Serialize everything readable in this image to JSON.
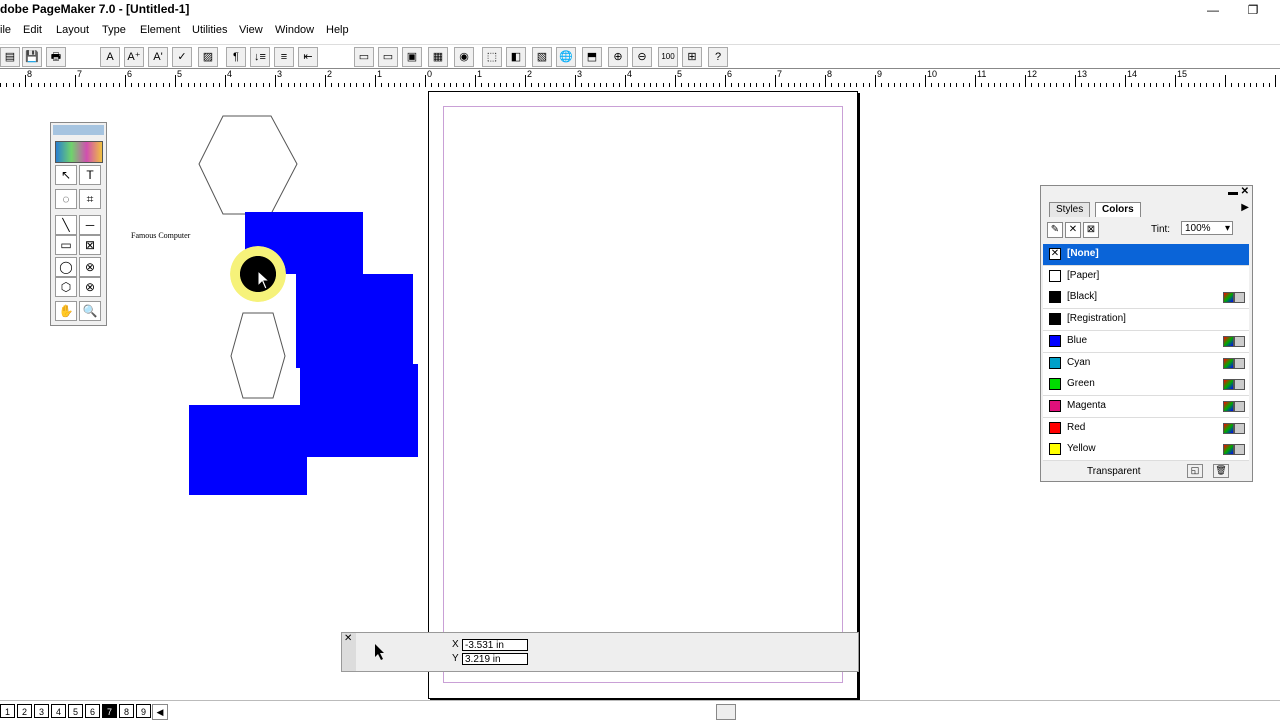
{
  "window": {
    "title": "dobe PageMaker 7.0 - [Untitled-1]",
    "minimize": "—",
    "restore": "❐"
  },
  "menu": [
    "ile",
    "Edit",
    "Layout",
    "Type",
    "Element",
    "Utilities",
    "View",
    "Window",
    "Help"
  ],
  "toolbar": [
    "▤",
    "💾",
    "🖶",
    "A",
    "A⁺",
    "A'",
    "✓",
    "▨",
    "¶",
    "↓≡",
    "≡",
    "⇤",
    "▭",
    "▭",
    "▣",
    "▦",
    "◉",
    "⬚",
    "◧",
    "▧",
    "🌐",
    "⬒",
    "⊕",
    "⊖",
    "100",
    "⊞",
    "?"
  ],
  "ruler_labels": [
    "8",
    "7",
    "6",
    "5",
    "4",
    "3",
    "2",
    "1",
    "0",
    "1",
    "2",
    "3",
    "4",
    "5",
    "6",
    "7",
    "8",
    "9",
    "10",
    "11",
    "12",
    "13",
    "14",
    "15"
  ],
  "toolbox_tools": [
    "↖",
    "T",
    "◌",
    "⌗",
    "╲",
    "─",
    "▭",
    "⊠",
    "◯",
    "⊗",
    "⬡",
    "⊗",
    "✋",
    "🔍"
  ],
  "pasteboard": {
    "label": "Famous Computer"
  },
  "palette": {
    "tabs": [
      "Styles",
      "Colors"
    ],
    "tint_label": "Tint:",
    "tint_value": "100%",
    "colors": [
      {
        "name": "[None]",
        "swatch": "#ffffff",
        "selected": true
      },
      {
        "name": "[Paper]",
        "swatch": "#ffffff"
      },
      {
        "name": "[Black]",
        "swatch": "#000000",
        "icons": true
      },
      {
        "name": "[Registration]",
        "swatch": "#000000"
      },
      {
        "name": "Blue",
        "swatch": "#0000ff",
        "icons": true
      },
      {
        "name": "Cyan",
        "swatch": "#00a0c8",
        "icons": true
      },
      {
        "name": "Green",
        "swatch": "#00dd00",
        "icons": true
      },
      {
        "name": "Magenta",
        "swatch": "#e0107a",
        "icons": true
      },
      {
        "name": "Red",
        "swatch": "#ff0000",
        "icons": true
      },
      {
        "name": "Yellow",
        "swatch": "#ffff00",
        "icons": true
      }
    ],
    "footer_label": "Transparent"
  },
  "control": {
    "x_label": "X",
    "y_label": "Y",
    "x_value": "-3.531 in",
    "y_value": "3.219 in"
  },
  "pages": [
    "1",
    "2",
    "3",
    "4",
    "5",
    "6",
    "7",
    "8",
    "9"
  ],
  "active_page": "7"
}
